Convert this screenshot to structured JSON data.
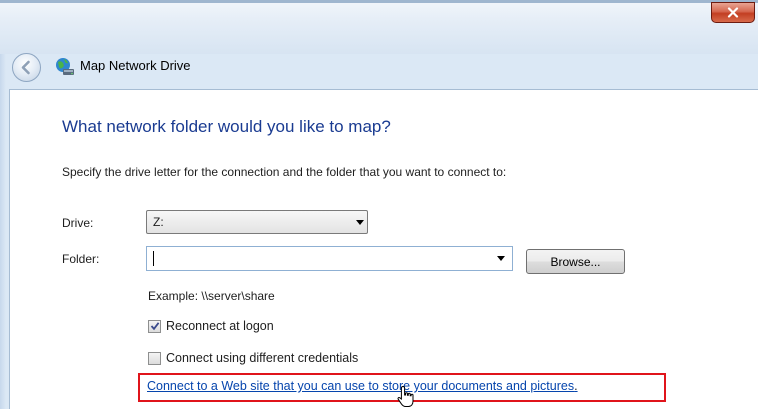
{
  "window": {
    "title": "Map Network Drive",
    "close_label": "x"
  },
  "main": {
    "heading": "What network folder would you like to map?",
    "instruction": "Specify the drive letter for the connection and the folder that you want to connect to:"
  },
  "drive": {
    "label": "Drive:",
    "value": "Z:"
  },
  "folder": {
    "label": "Folder:",
    "value": "",
    "browse_label": "Browse...",
    "example": "Example: \\\\server\\share"
  },
  "options": {
    "reconnect": {
      "label": "Reconnect at logon",
      "checked": true
    },
    "credentials": {
      "label": "Connect using different credentials",
      "checked": false
    }
  },
  "web_link": {
    "text": "Connect to a Web site that you can use to store your documents and pictures",
    "suffix": "."
  },
  "colors": {
    "heading": "#1a3b91",
    "link": "#0645ad",
    "highlight_box": "#e0141b",
    "close_button": "#c23e22"
  },
  "icons": {
    "back": "back-arrow-icon",
    "app": "network-drive-icon",
    "close": "close-icon",
    "cursor": "hand-pointer-icon"
  }
}
